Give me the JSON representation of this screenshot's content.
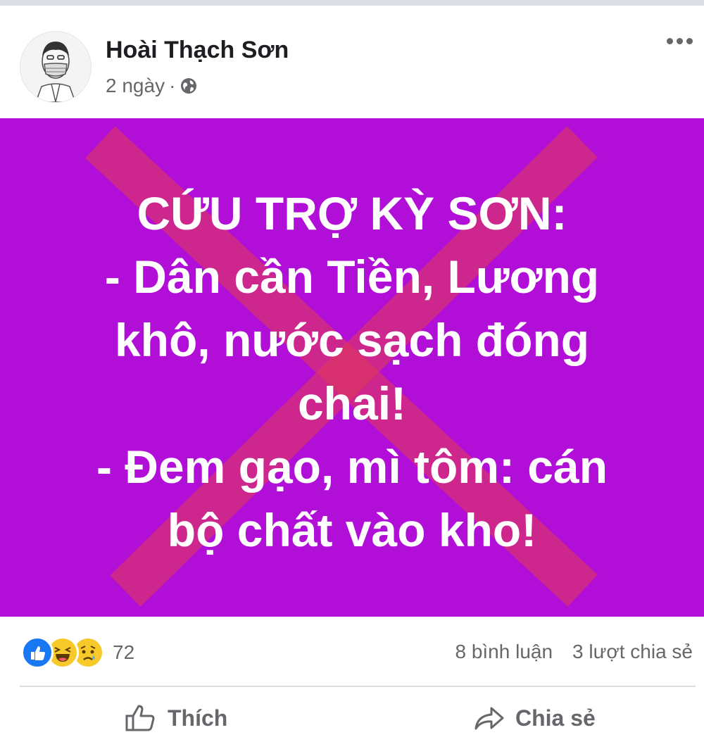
{
  "post": {
    "author": "Hoài Thạch Sơn",
    "time": "2 ngày",
    "separator": "·",
    "privacy_icon": "globe-icon",
    "more_icon": "more-options-icon"
  },
  "image": {
    "background_color": "#b10fd8",
    "overlay_color": "#e0355a",
    "lines": [
      "CỨU TRỢ KỲ SƠN:",
      "- Dân cần Tiền, Lương",
      "khô, nước sạch đóng",
      "chai!",
      "- Đem gạo, mì tôm: cán",
      "bộ chất vào kho!"
    ]
  },
  "stats": {
    "reaction_icons": [
      "like-reaction-icon",
      "haha-reaction-icon",
      "sad-reaction-icon"
    ],
    "reaction_count": "72",
    "comments": "8 bình luận",
    "shares": "3 lượt chia sẻ"
  },
  "actions": {
    "like_label": "Thích",
    "share_label": "Chia sẻ"
  }
}
